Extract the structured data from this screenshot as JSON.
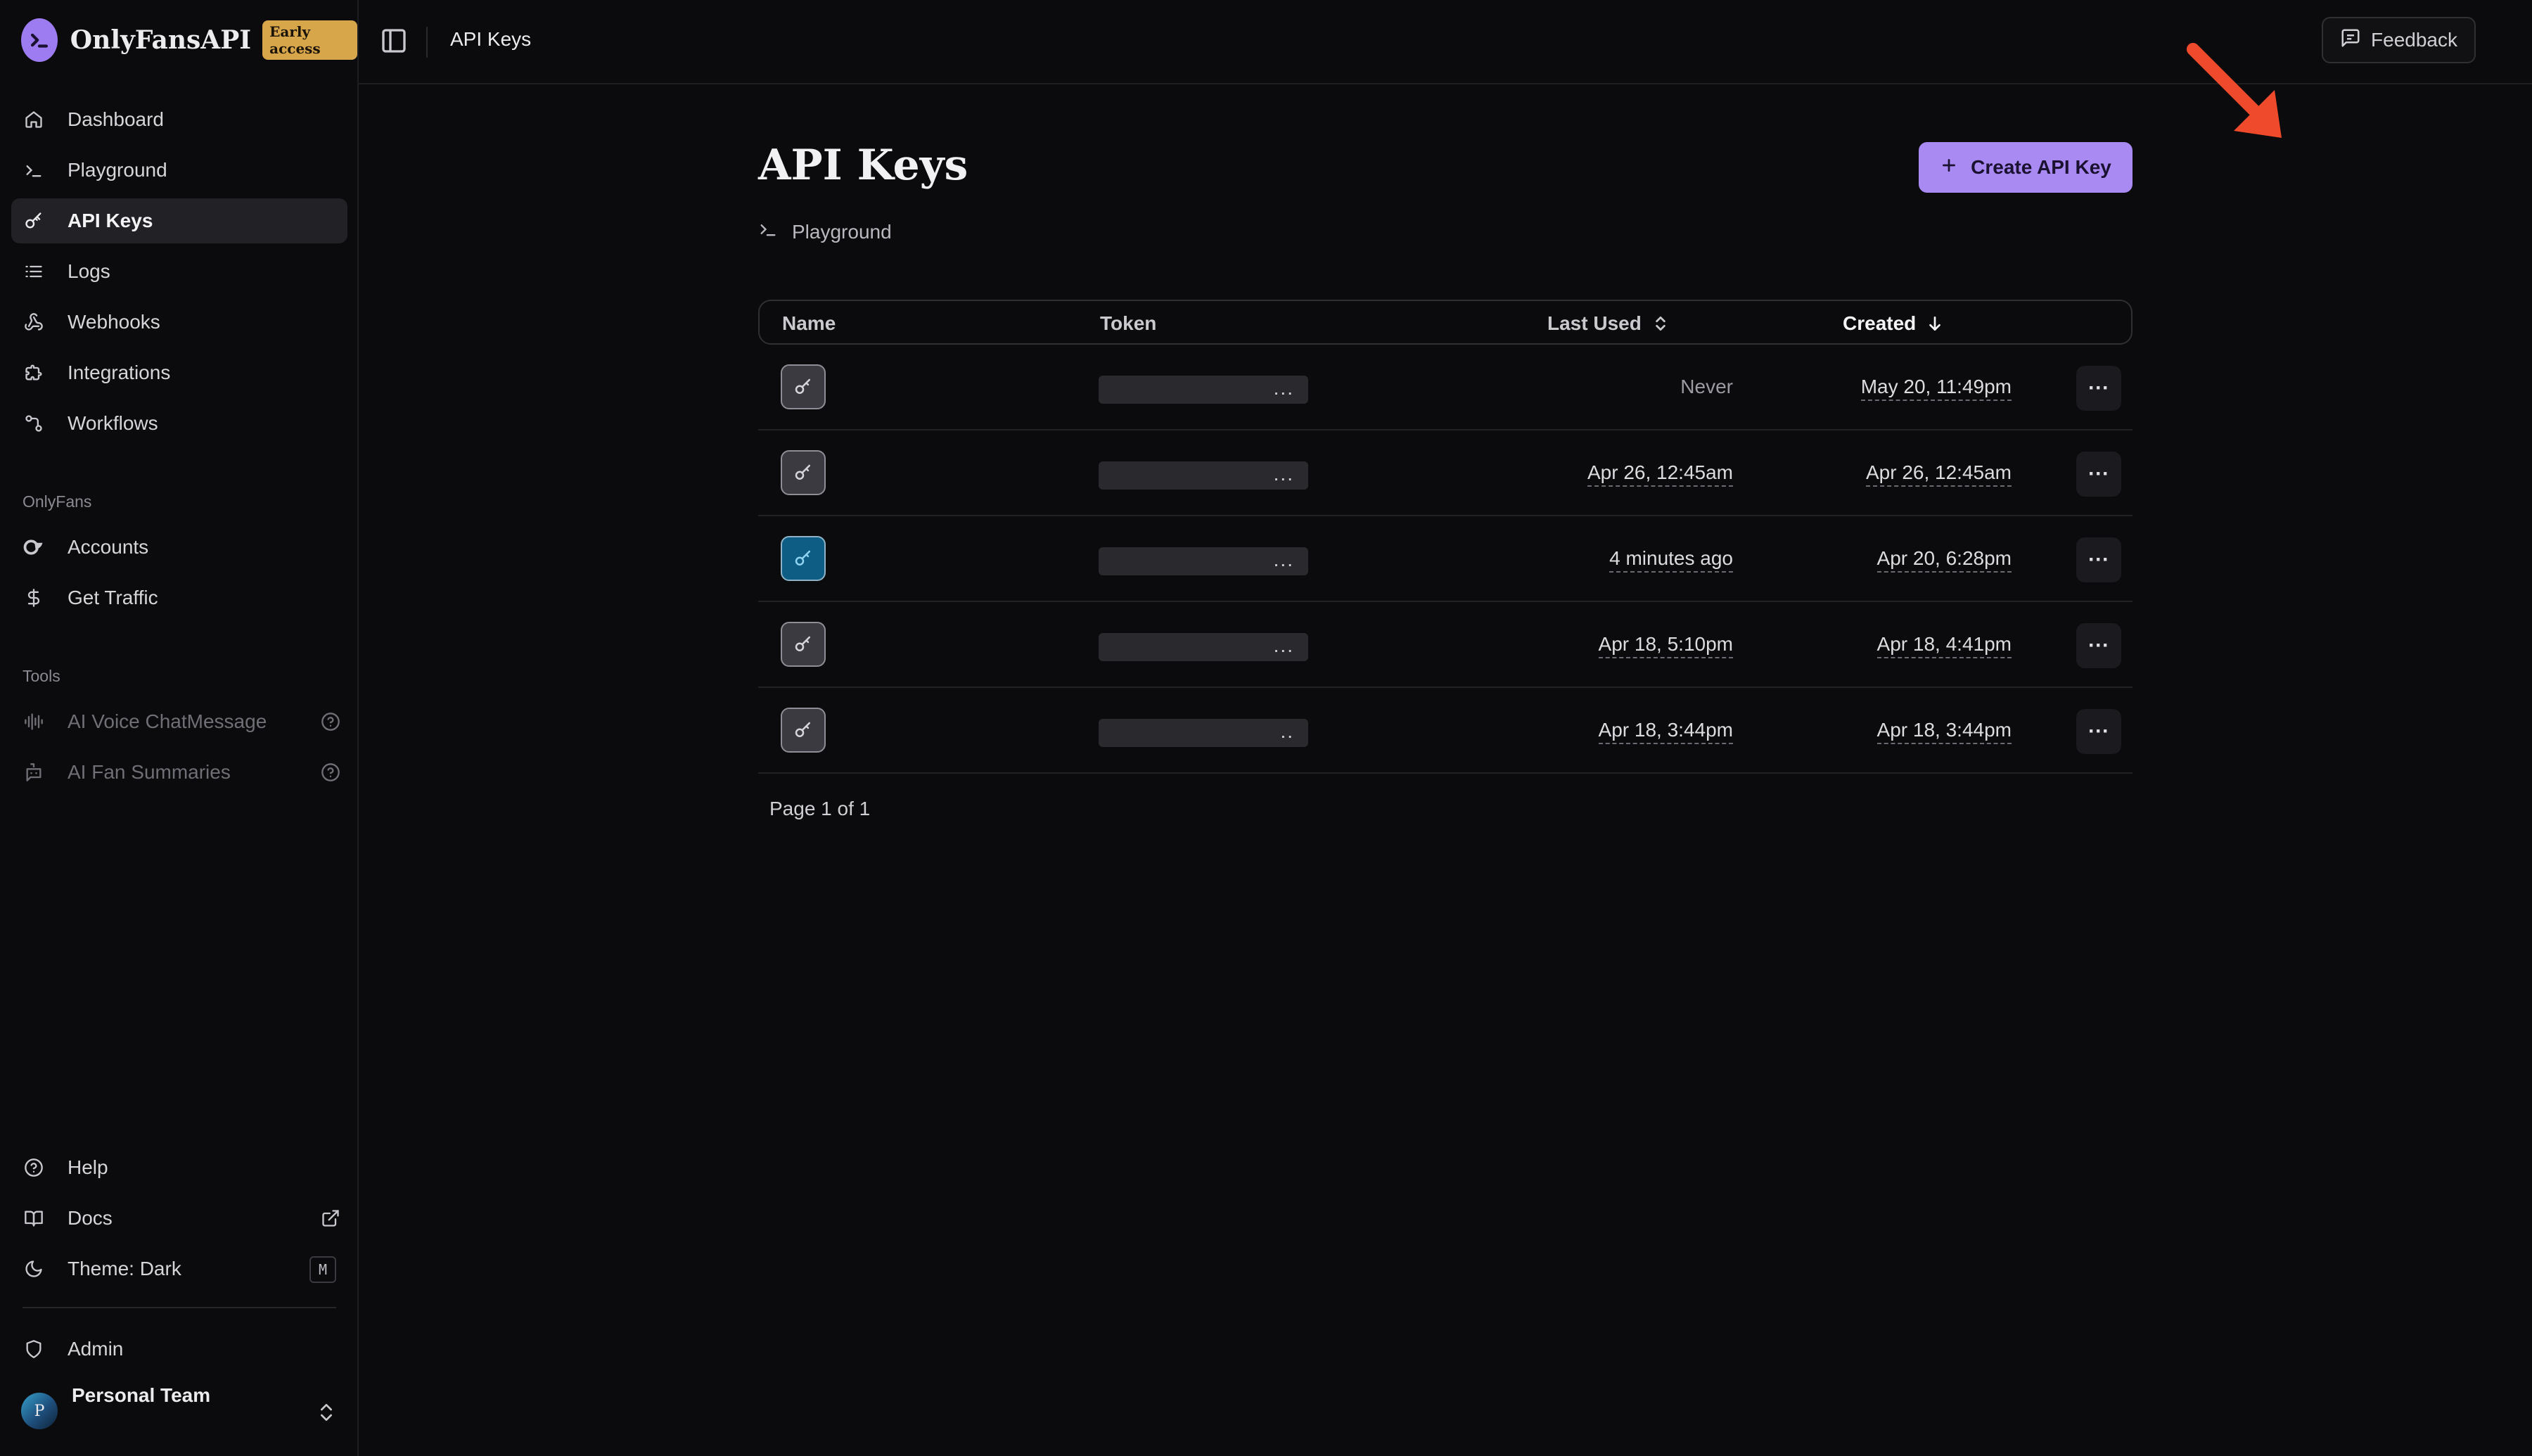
{
  "brand": {
    "name": "OnlyFansAPI",
    "badge": "Early access",
    "accent": "#9d7bf0"
  },
  "sidebar": {
    "main_items": [
      {
        "label": "Dashboard",
        "icon": "home-icon"
      },
      {
        "label": "Playground",
        "icon": "terminal-icon"
      },
      {
        "label": "API Keys",
        "icon": "key-icon",
        "active": true
      },
      {
        "label": "Logs",
        "icon": "list-icon"
      },
      {
        "label": "Webhooks",
        "icon": "webhook-icon"
      },
      {
        "label": "Integrations",
        "icon": "puzzle-icon"
      },
      {
        "label": "Workflows",
        "icon": "workflow-icon"
      }
    ],
    "onlyfans_label": "OnlyFans",
    "onlyfans_items": [
      {
        "label": "Accounts",
        "icon": "onlyfans-logo-icon"
      },
      {
        "label": "Get Traffic",
        "icon": "dollar-icon"
      }
    ],
    "tools_label": "Tools",
    "tools_items": [
      {
        "label": "AI Voice ChatMessage",
        "icon": "audio-wave-icon"
      },
      {
        "label": "AI Fan Summaries",
        "icon": "bot-message-icon"
      }
    ],
    "bottom_items": [
      {
        "label": "Help",
        "icon": "help-circle-icon"
      },
      {
        "label": "Docs",
        "icon": "book-icon"
      },
      {
        "label": "Theme: Dark",
        "icon": "moon-icon",
        "shortcut": "M"
      }
    ],
    "admin_label": "Admin",
    "team": {
      "name": "Personal Team",
      "avatar_letter": "P"
    }
  },
  "topbar": {
    "breadcrumb": "API Keys",
    "feedback_label": "Feedback"
  },
  "page": {
    "title": "API Keys",
    "playground_link": "Playground",
    "create_button": "Create API Key",
    "create_button_color": "#a98af3",
    "annotation_arrow_color": "#ee4a2b"
  },
  "table": {
    "columns": {
      "name": "Name",
      "token": "Token",
      "last_used": "Last Used",
      "created": "Created"
    },
    "sort": {
      "column": "created",
      "direction": "desc"
    },
    "rows": [
      {
        "token_suffix": "...",
        "last_used": "Never",
        "created": "May 20, 11:49pm",
        "icon_color": "gray"
      },
      {
        "token_suffix": "...",
        "last_used": "Apr 26, 12:45am",
        "created": "Apr 26, 12:45am",
        "icon_color": "gray"
      },
      {
        "token_suffix": "...",
        "last_used": "4 minutes ago",
        "created": "Apr 20, 6:28pm",
        "icon_color": "blue"
      },
      {
        "token_suffix": "...",
        "last_used": "Apr 18, 5:10pm",
        "created": "Apr 18, 4:41pm",
        "icon_color": "gray"
      },
      {
        "token_suffix": "..",
        "last_used": "Apr 18, 3:44pm",
        "created": "Apr 18, 3:44pm",
        "icon_color": "gray"
      }
    ],
    "row_menu_label": "···",
    "pagination": "Page 1 of 1"
  }
}
